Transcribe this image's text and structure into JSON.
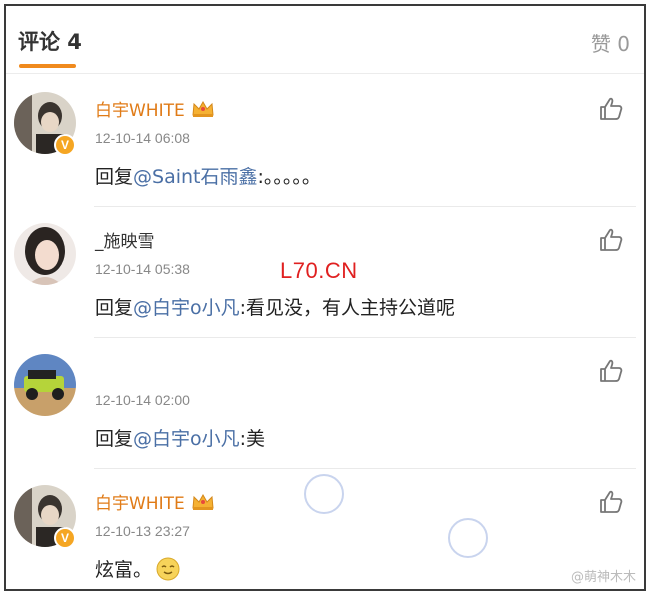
{
  "header": {
    "comments_tab": "评论 4",
    "likes_tab": "赞 0"
  },
  "comments": [
    {
      "username": "白宇WHITE",
      "time": "12-10-14 06:08",
      "reply_prefix": "回复",
      "mention": "@Saint石雨鑫",
      "text": ":。。。。。"
    },
    {
      "username": "_施映雪",
      "time": "12-10-14 05:38",
      "reply_prefix": "回复",
      "mention": "@白宇o小凡",
      "text": ":看见没，有人主持公道呢"
    },
    {
      "username": "",
      "time": "12-10-14 02:00",
      "reply_prefix": "回复",
      "mention": "@白宇o小凡",
      "text": ":美"
    },
    {
      "username": "白宇WHITE",
      "time": "12-10-13 23:27",
      "reply_prefix": "",
      "mention": "",
      "text": "炫富。"
    }
  ],
  "watermark": "L70.CN",
  "source_mark": "@萌神木木",
  "colors": {
    "accent": "#f08a1d",
    "vip_name": "#e07b17",
    "mention": "#4a6fa5",
    "watermark": "#e02020"
  },
  "icons": [
    "thumbs-up-icon",
    "crown-icon",
    "verified-badge-icon",
    "smiley-emoji-icon"
  ]
}
